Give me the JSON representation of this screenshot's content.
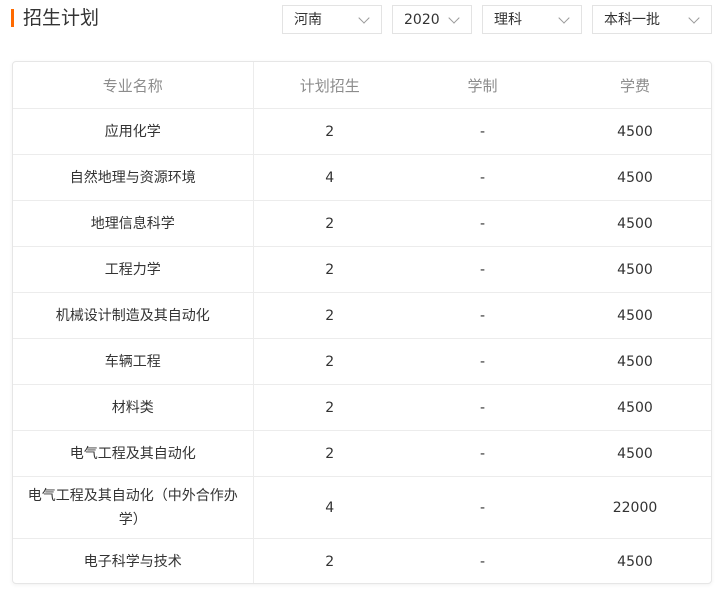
{
  "header": {
    "title": "招生计划",
    "accent_color": "#ff6a00",
    "filters": {
      "province": "河南",
      "year": "2020",
      "category": "理科",
      "batch": "本科一批"
    }
  },
  "table": {
    "columns": [
      "专业名称",
      "计划招生",
      "学制",
      "学费"
    ],
    "rows": [
      {
        "name": "应用化学",
        "plan": "2",
        "duration": "-",
        "fee": "4500"
      },
      {
        "name": "自然地理与资源环境",
        "plan": "4",
        "duration": "-",
        "fee": "4500"
      },
      {
        "name": "地理信息科学",
        "plan": "2",
        "duration": "-",
        "fee": "4500"
      },
      {
        "name": "工程力学",
        "plan": "2",
        "duration": "-",
        "fee": "4500"
      },
      {
        "name": "机械设计制造及其自动化",
        "plan": "2",
        "duration": "-",
        "fee": "4500"
      },
      {
        "name": "车辆工程",
        "plan": "2",
        "duration": "-",
        "fee": "4500"
      },
      {
        "name": "材料类",
        "plan": "2",
        "duration": "-",
        "fee": "4500"
      },
      {
        "name": "电气工程及其自动化",
        "plan": "2",
        "duration": "-",
        "fee": "4500"
      },
      {
        "name": "电气工程及其自动化（中外合作办学）",
        "plan": "4",
        "duration": "-",
        "fee": "22000"
      },
      {
        "name": "电子科学与技术",
        "plan": "2",
        "duration": "-",
        "fee": "4500"
      }
    ]
  }
}
